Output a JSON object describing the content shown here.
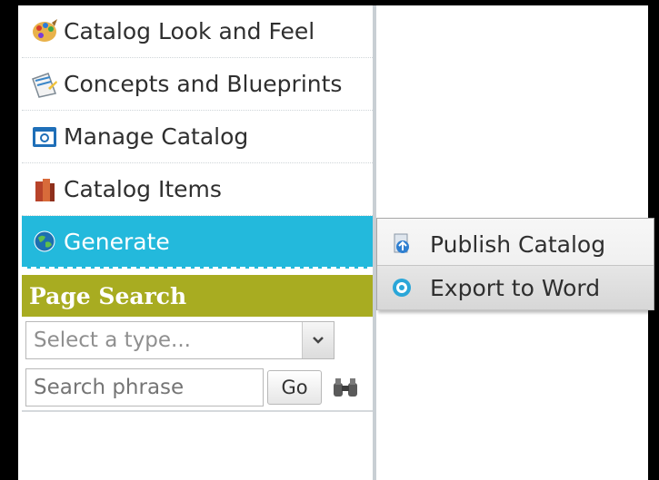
{
  "menu": {
    "items": [
      {
        "label": "Catalog Look and Feel",
        "icon": "palette-icon"
      },
      {
        "label": "Concepts and Blueprints",
        "icon": "blueprint-icon"
      },
      {
        "label": "Manage Catalog",
        "icon": "manage-catalog-icon"
      },
      {
        "label": "Catalog Items",
        "icon": "books-icon"
      },
      {
        "label": "Generate",
        "icon": "globe-icon",
        "active": true
      }
    ]
  },
  "page_search": {
    "title": "Page Search",
    "type_select": {
      "value": "Select a type..."
    },
    "phrase_input": {
      "placeholder": "Search phrase"
    },
    "go_label": "Go",
    "advanced_icon": "binoculars-icon"
  },
  "generate_flyout": {
    "items": [
      {
        "label": "Publish Catalog",
        "icon": "publish-icon"
      },
      {
        "label": "Export to Word",
        "icon": "export-word-icon"
      }
    ]
  },
  "colors": {
    "active_item": "#23b9dc",
    "search_header": "#a8ac21",
    "border": "#000000"
  }
}
